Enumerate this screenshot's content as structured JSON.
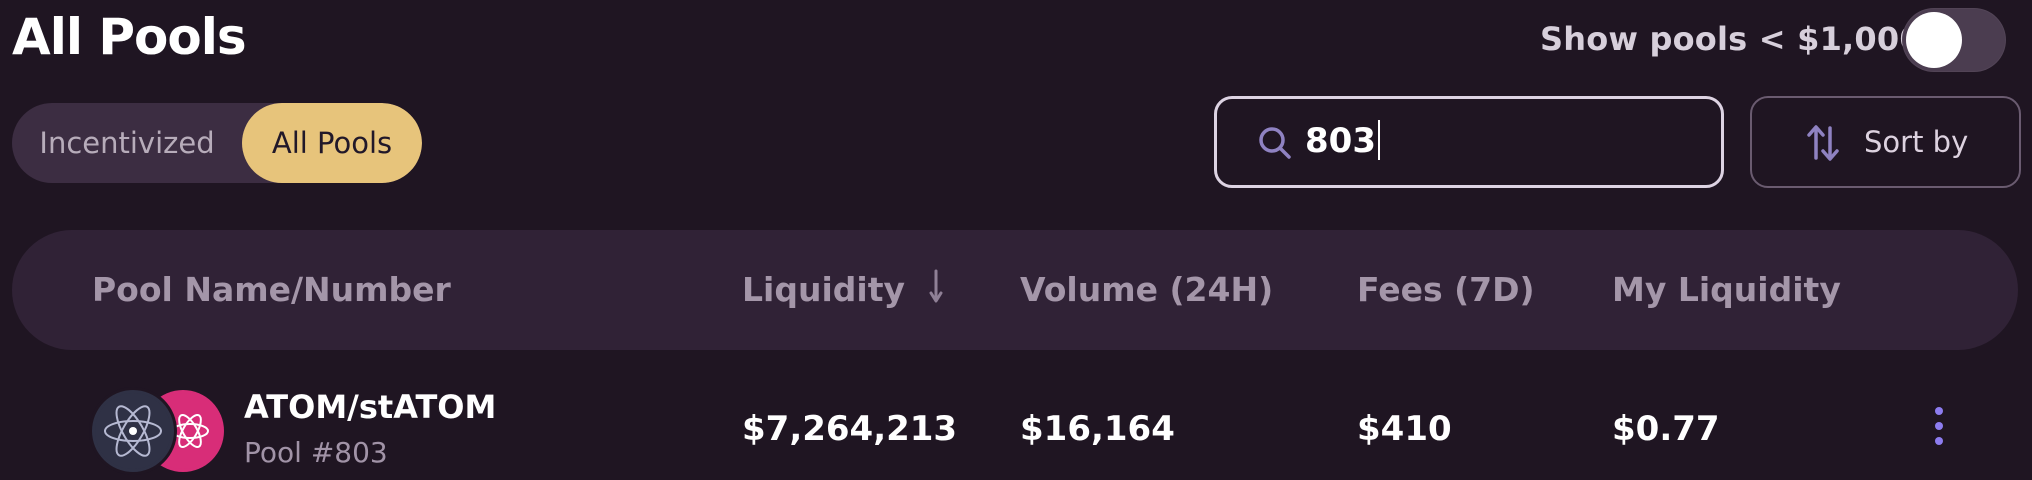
{
  "header": {
    "title": "All Pools",
    "toggle": {
      "label": "Show pools < $1,000",
      "enabled": false
    }
  },
  "filters": {
    "tabs": [
      {
        "label": "Incentivized",
        "active": false
      },
      {
        "label": "All Pools",
        "active": true
      }
    ],
    "search": {
      "value": "803",
      "icon": "search-icon"
    },
    "sort": {
      "label": "Sort by",
      "icon": "sort-icon"
    }
  },
  "table": {
    "headers": {
      "pool": "Pool Name/Number",
      "liquidity": "Liquidity",
      "volume": "Volume (24H)",
      "fees": "Fees (7D)",
      "my_liquidity": "My Liquidity"
    },
    "rows": [
      {
        "pool_name": "ATOM/stATOM",
        "pool_number": "Pool #803",
        "liquidity": "$7,264,213",
        "volume": "$16,164",
        "fees": "$410",
        "my_liquidity": "$0.77",
        "token_icons": [
          "atom-icon",
          "statom-icon"
        ]
      }
    ]
  },
  "colors": {
    "background": "#1f1522",
    "surface": "#302236",
    "accent": "#e7c47b",
    "atom_icon_bg": "#2f3145",
    "statom_icon_bg": "#d82d78",
    "menu_dots": "#8d7cf0"
  }
}
